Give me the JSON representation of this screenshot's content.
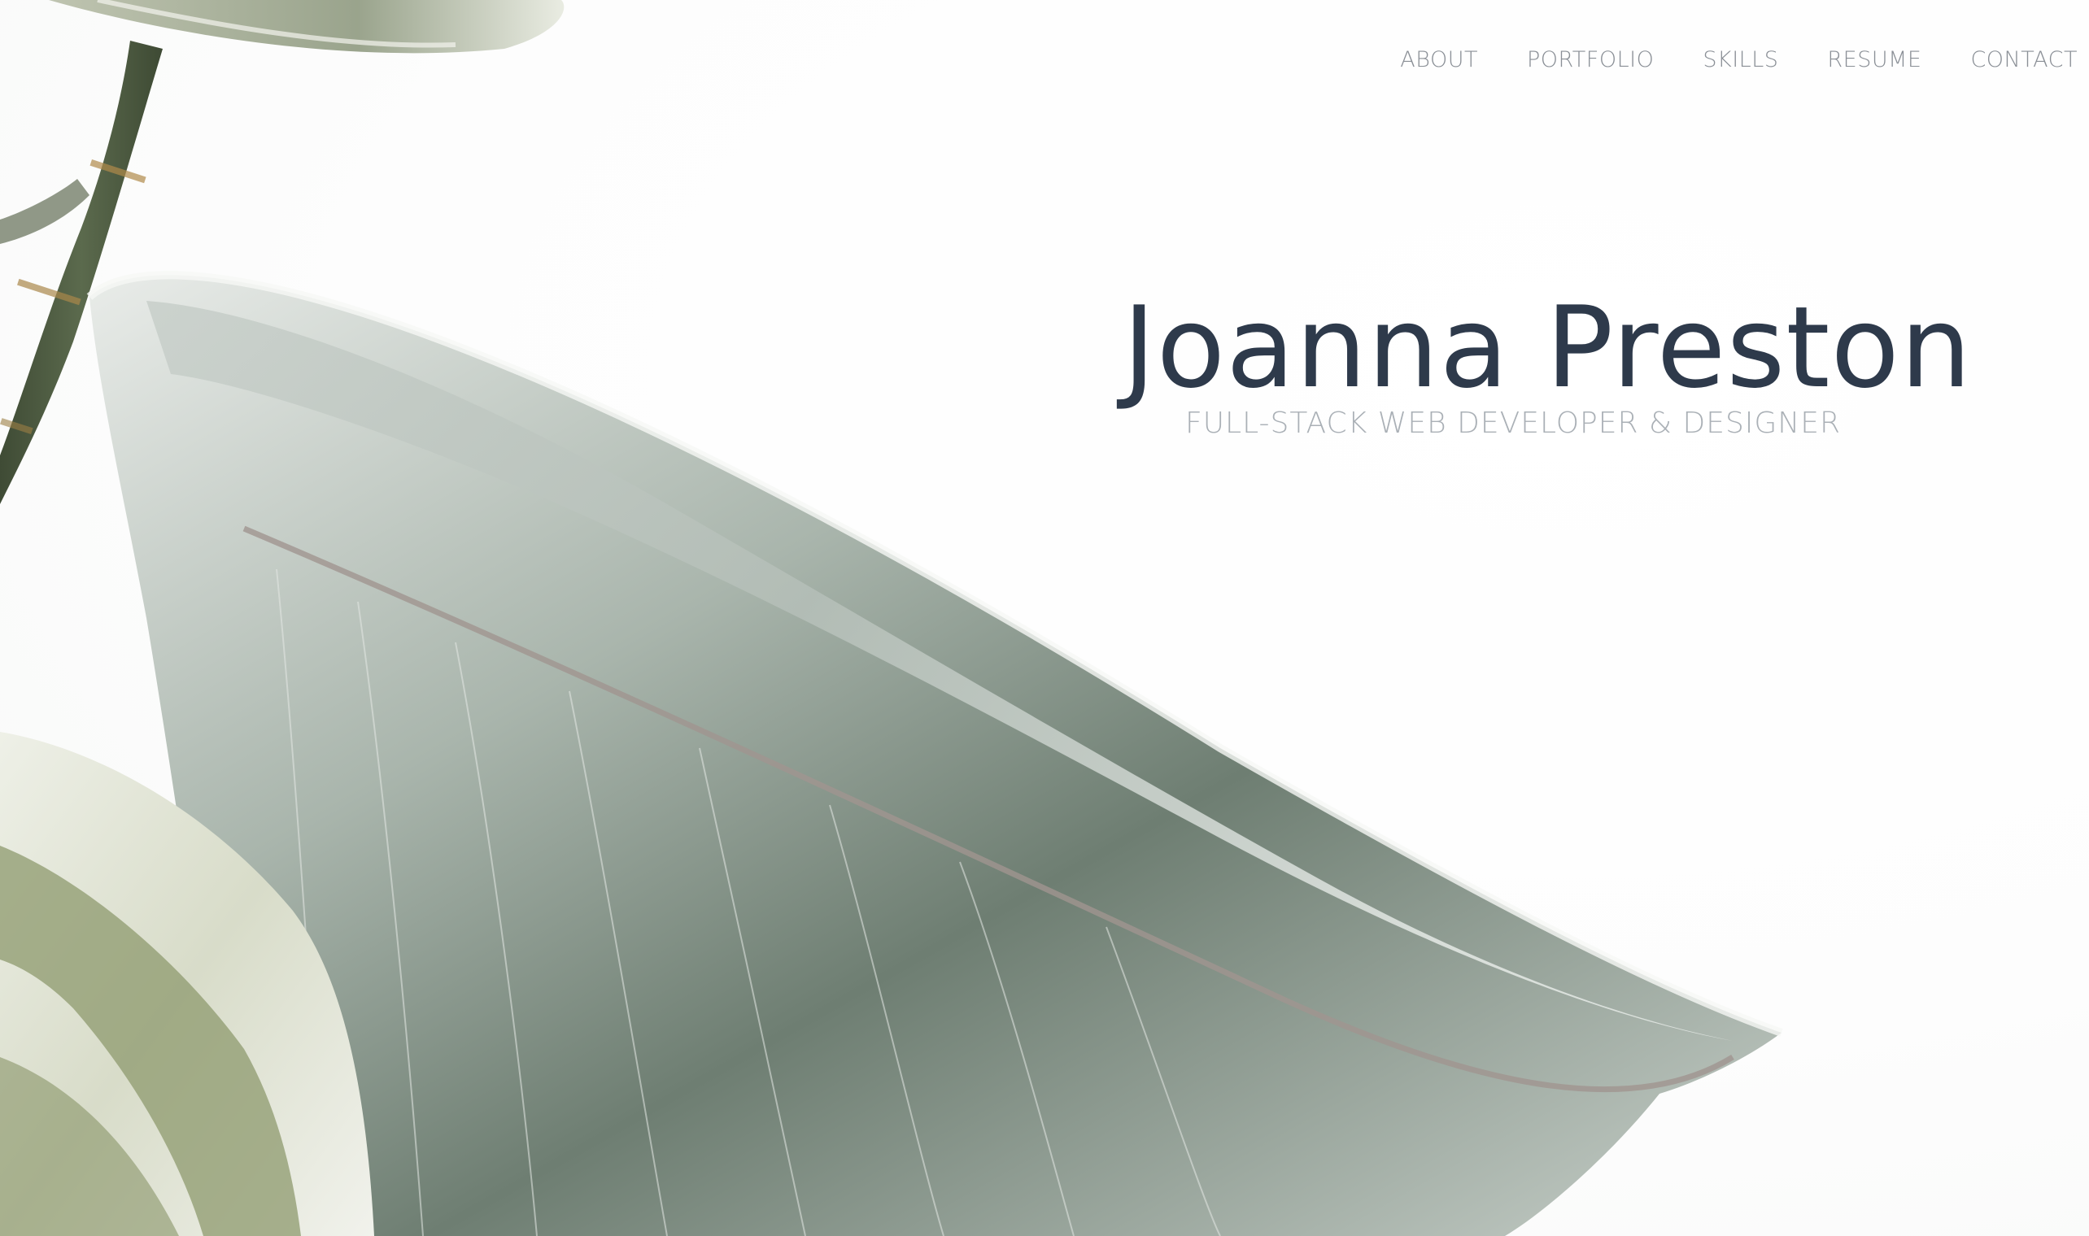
{
  "nav": {
    "items": [
      {
        "label": "ABOUT"
      },
      {
        "label": "PORTFOLIO"
      },
      {
        "label": "SKILLS"
      },
      {
        "label": "RESUME"
      },
      {
        "label": "CONTACT"
      }
    ]
  },
  "hero": {
    "title": "Joanna Preston",
    "subtitle": "FULL-STACK WEB DEVELOPER & DESIGNER"
  },
  "colors": {
    "title": "#2e3a4b",
    "subtitle": "#aab0b6",
    "nav": "#8a8f96",
    "leaf_dark": "#5f6d63",
    "leaf_light": "#d6ddd8",
    "stem": "#4f5e45"
  }
}
